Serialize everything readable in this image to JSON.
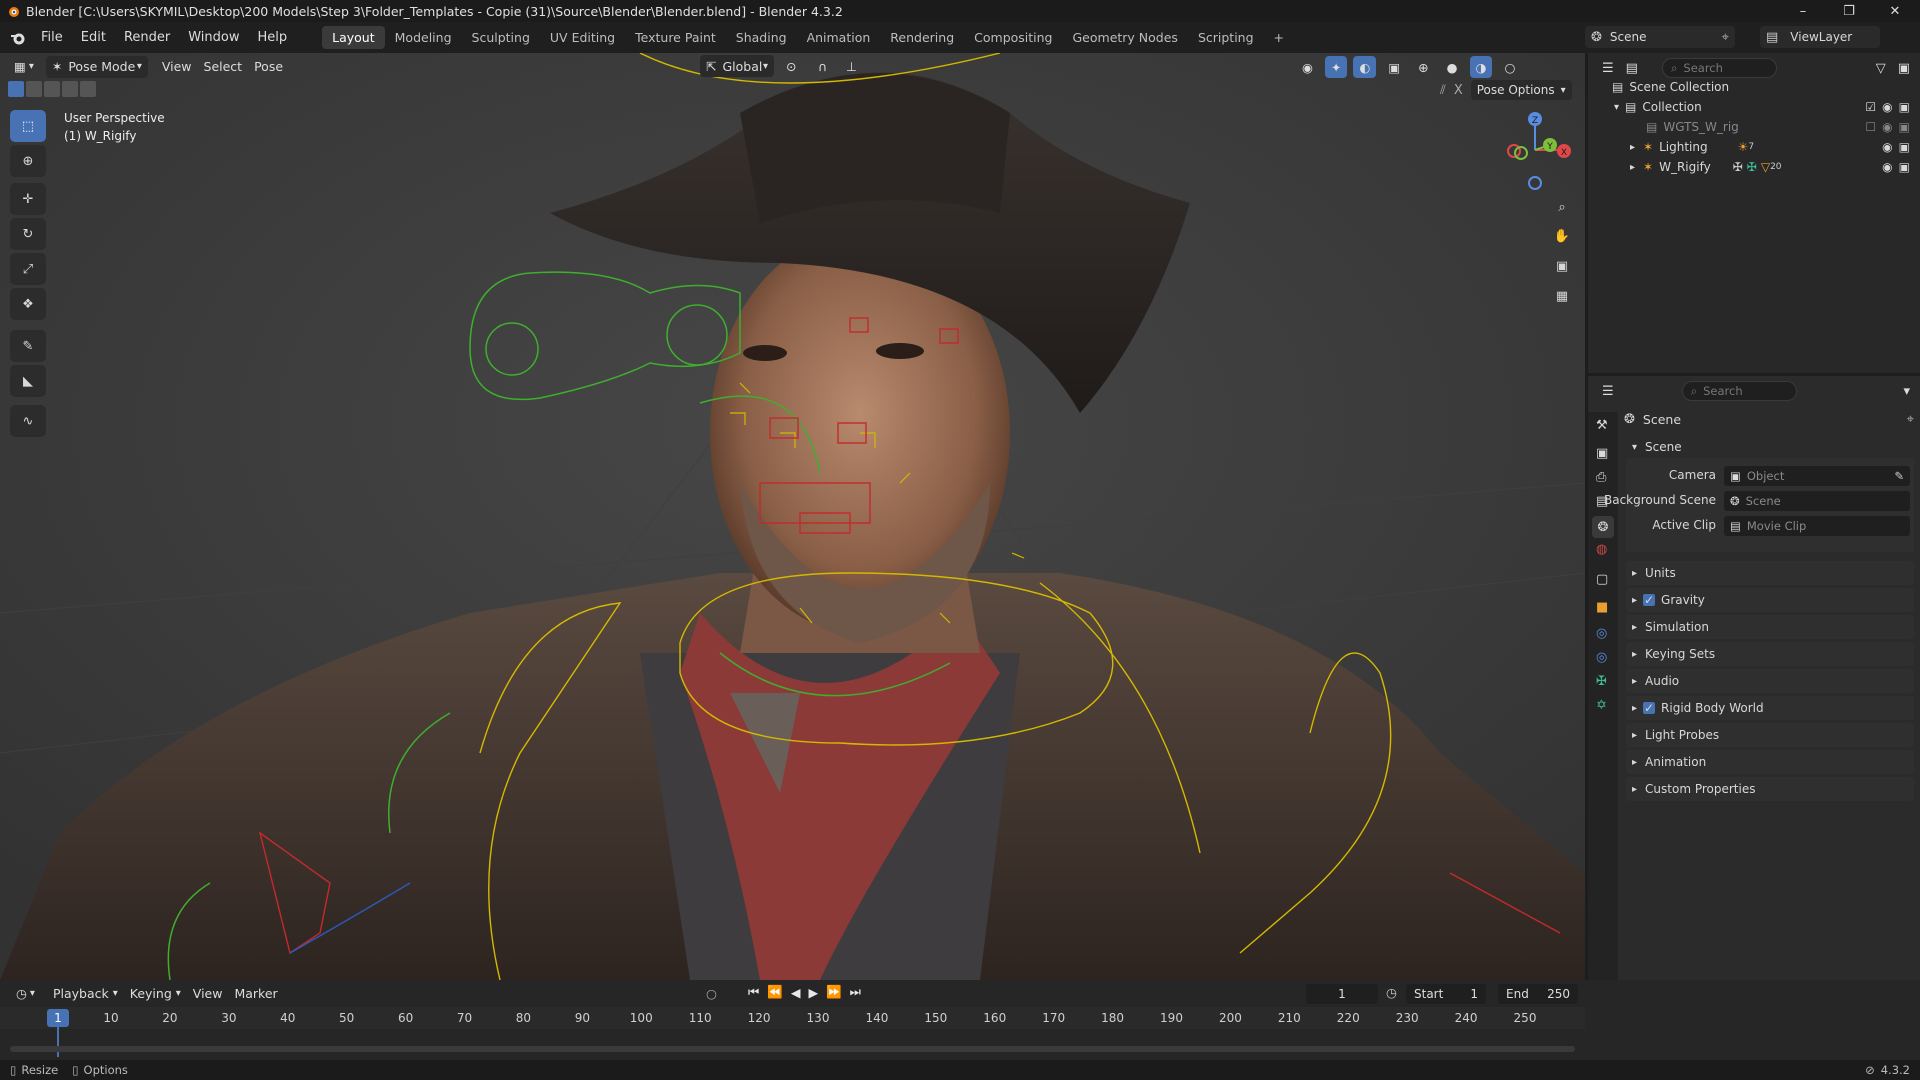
{
  "window": {
    "title": "Blender [C:\\Users\\SKYMIL\\Desktop\\200 Models\\Step 3\\Folder_Templates - Copie (31)\\Source\\Blender\\Blender.blend] - Blender 4.3.2"
  },
  "menus": [
    "File",
    "Edit",
    "Render",
    "Window",
    "Help"
  ],
  "workspaces": [
    "Layout",
    "Modeling",
    "Sculpting",
    "UV Editing",
    "Texture Paint",
    "Shading",
    "Animation",
    "Rendering",
    "Compositing",
    "Geometry Nodes",
    "Scripting"
  ],
  "active_workspace": "Layout",
  "scene_selector": "Scene",
  "viewlayer_selector": "ViewLayer",
  "viewport": {
    "mode": "Pose Mode",
    "menus": [
      "View",
      "Select",
      "Pose"
    ],
    "orientation": "Global",
    "pose_options": "Pose Options",
    "overlay_line1": "User Perspective",
    "overlay_line2": "(1) W_Rigify",
    "axes": {
      "x": "X",
      "y": "Y",
      "z": "Z"
    }
  },
  "outliner": {
    "search_placeholder": "Search",
    "scene_collection": "Scene Collection",
    "items": [
      {
        "name": "Collection",
        "level": 1
      },
      {
        "name": "WGTS_W_rig",
        "level": 2
      },
      {
        "name": "Lighting",
        "level": 2,
        "badge": "7"
      },
      {
        "name": "W_Rigify",
        "level": 2,
        "badge": "20"
      }
    ]
  },
  "properties": {
    "search_placeholder": "Search",
    "context": "Scene",
    "panel": "Scene",
    "fields": [
      {
        "label": "Camera",
        "placeholder": "Object"
      },
      {
        "label": "Background Scene",
        "placeholder": "Scene"
      },
      {
        "label": "Active Clip",
        "placeholder": "Movie Clip"
      }
    ],
    "sections": [
      {
        "label": "Units",
        "checkbox": false
      },
      {
        "label": "Gravity",
        "checkbox": true
      },
      {
        "label": "Simulation",
        "checkbox": false
      },
      {
        "label": "Keying Sets",
        "checkbox": false
      },
      {
        "label": "Audio",
        "checkbox": false
      },
      {
        "label": "Rigid Body World",
        "checkbox": true
      },
      {
        "label": "Light Probes",
        "checkbox": false
      },
      {
        "label": "Animation",
        "checkbox": false
      },
      {
        "label": "Custom Properties",
        "checkbox": false
      }
    ]
  },
  "timeline": {
    "menus": [
      "Playback",
      "Keying",
      "View",
      "Marker"
    ],
    "current_frame": "1",
    "start_label": "Start",
    "start": "1",
    "end_label": "End",
    "end": "250",
    "ticks": [
      "1",
      "10",
      "20",
      "30",
      "40",
      "50",
      "60",
      "70",
      "80",
      "90",
      "100",
      "110",
      "120",
      "130",
      "140",
      "150",
      "160",
      "170",
      "180",
      "190",
      "200",
      "210",
      "220",
      "230",
      "240",
      "250"
    ]
  },
  "statusbar": {
    "resize": "Resize",
    "options": "Options",
    "version": "4.3.2"
  },
  "colors": {
    "accent": "#4772b3",
    "viewport_bg": "#3b3b3b",
    "panel_bg": "#2b2b2b",
    "yellow_bone": "#d4b800",
    "green_bone": "#3fae2f",
    "red_bone": "#c42a2a"
  }
}
